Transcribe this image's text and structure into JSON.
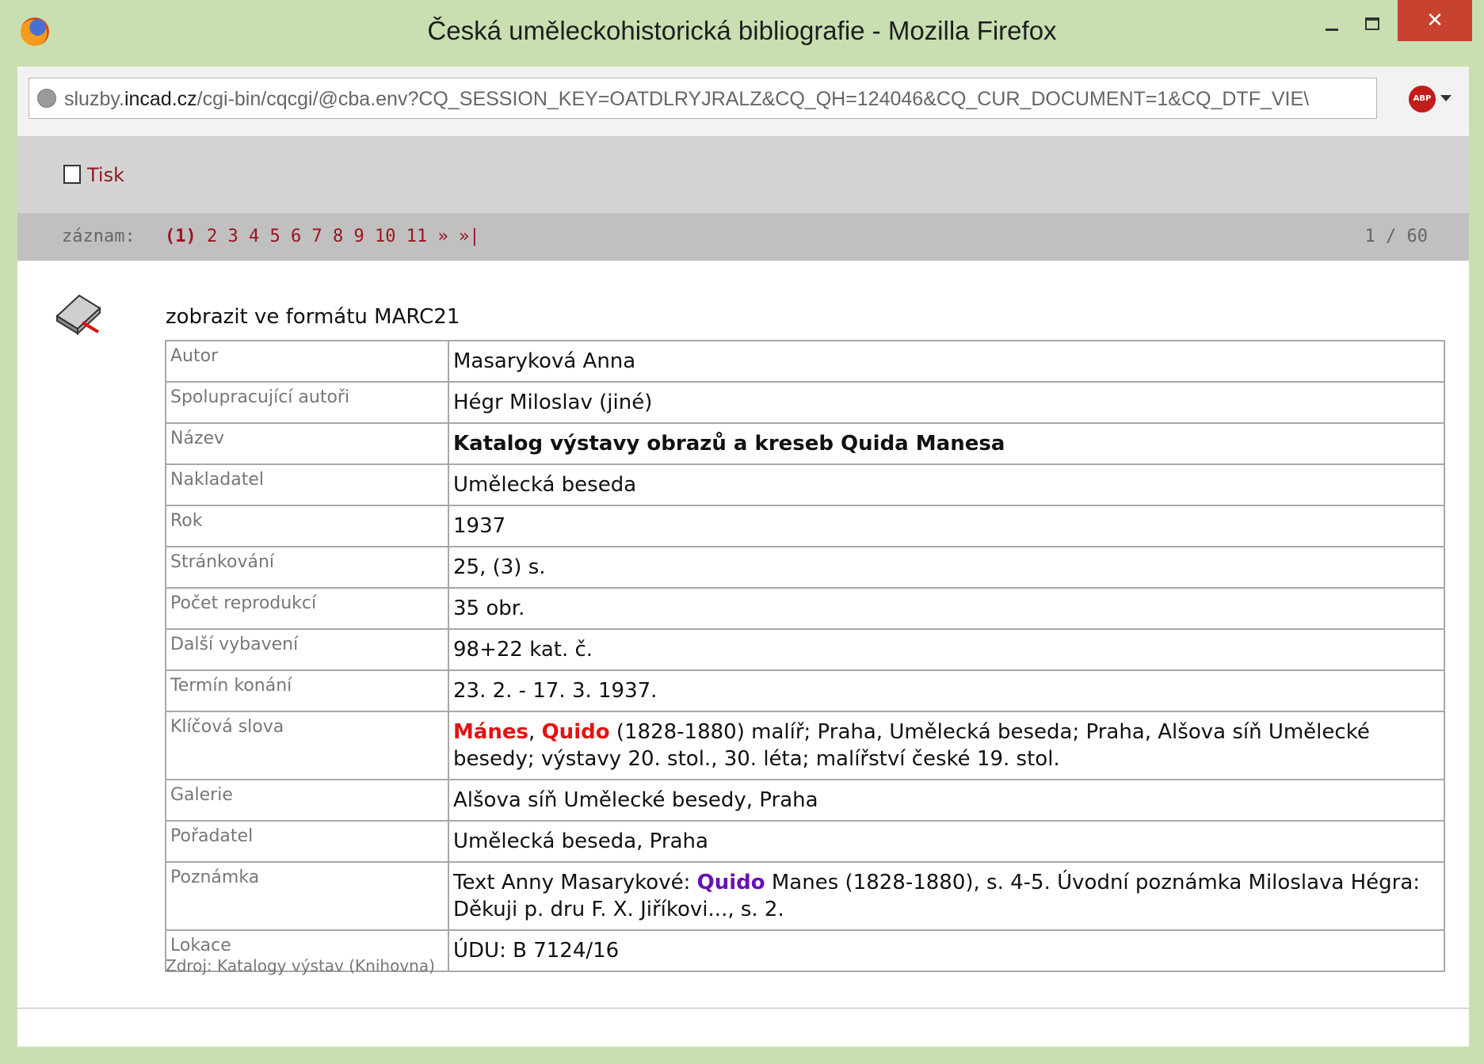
{
  "window": {
    "title": "Česká uměleckohistorická bibliografie - Mozilla Firefox",
    "close_glyph": "✕"
  },
  "addressbar": {
    "url_prefix": "sluzby.",
    "url_domain": "incad.cz",
    "url_rest": "/cgi-bin/cqcgi/@cba.env?CQ_SESSION_KEY=OATDLRYJRALZ&CQ_QH=124046&CQ_CUR_DOCUMENT=1&CQ_DTF_VIE\\",
    "abp_label": "ABP"
  },
  "toolbar": {
    "print_label": "Tisk"
  },
  "navigation": {
    "label": "záznam:",
    "current": "(1)",
    "pages": [
      "2",
      "3",
      "4",
      "5",
      "6",
      "7",
      "8",
      "9",
      "10",
      "11"
    ],
    "next": "»",
    "last": "»|",
    "count": "1 / 60"
  },
  "main": {
    "marc_link": "zobrazit ve formátu MARC21",
    "source": "Zdroj: Katalogy výstav (Knihovna)"
  },
  "record": {
    "author_label": "Autor",
    "author": "Masaryková Anna",
    "coauthors_label": "Spolupracující autoři",
    "coauthors": "Hégr Miloslav (jiné)",
    "title_label": "Název",
    "title": "Katalog výstavy obrazů a kreseb Quida Manesa",
    "publisher_label": "Nakladatel",
    "publisher": "Umělecká beseda",
    "year_label": "Rok",
    "year": "1937",
    "pages_label": "Stránkování",
    "pages": "25, (3) s.",
    "repro_label": "Počet reprodukcí",
    "repro": "35 obr.",
    "equipment_label": "Další vybavení",
    "equipment": "98+22 kat. č.",
    "date_label": "Termín konání",
    "date": "23. 2. - 17. 3. 1937.",
    "keywords_label": "Klíčová slova",
    "kw_manes": "Mánes",
    "kw_sep": ", ",
    "kw_quido": "Quido",
    "kw_rest": " (1828-1880) malíř; Praha, Umělecká beseda; Praha, Alšova síň Umělecké besedy; výstavy 20. stol., 30. léta; malířství české 19. stol.",
    "gallery_label": "Galerie",
    "gallery": "Alšova síň Umělecké besedy, Praha",
    "organizer_label": "Pořadatel",
    "organizer": "Umělecká beseda, Praha",
    "note_label": "Poznámka",
    "note_pre": "Text Anny Masarykové: ",
    "note_quido": "Quido",
    "note_post": " Manes (1828-1880), s. 4-5. Úvodní poznámka Miloslava Hégra: Děkuji p. dru F. X. Jiříkovi..., s. 2.",
    "location_label": "Lokace",
    "location": "ÚDU: B 7124/16"
  }
}
